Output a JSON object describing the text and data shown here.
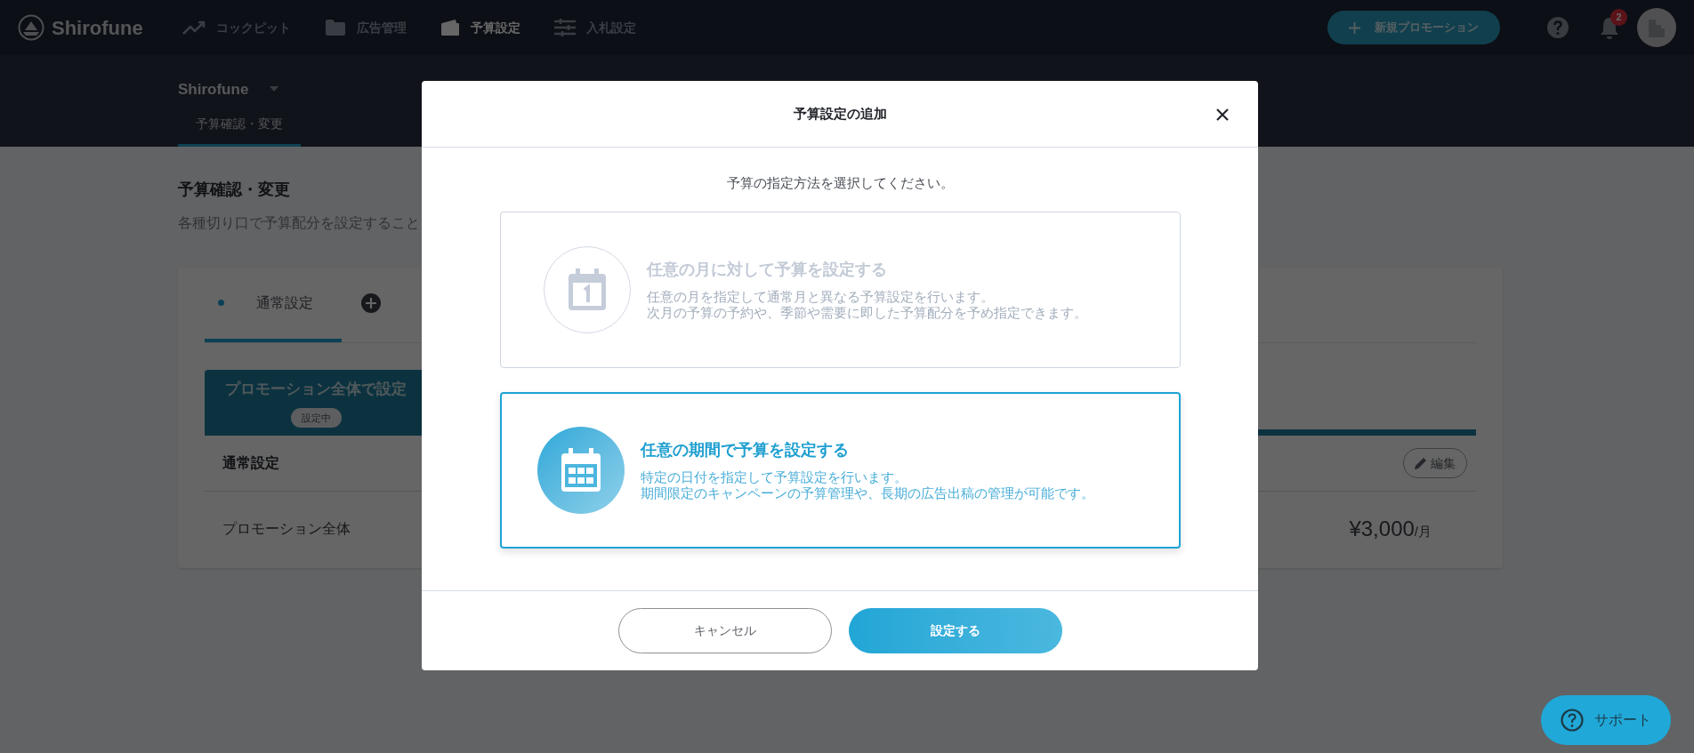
{
  "nav": {
    "logo": "Shirofune",
    "items": [
      {
        "label": "コックピット",
        "kind": "trend",
        "selected": false
      },
      {
        "label": "広告管理",
        "kind": "folder",
        "selected": false
      },
      {
        "label": "予算設定",
        "kind": "wallet",
        "selected": true
      },
      {
        "label": "入札設定",
        "kind": "sliders",
        "selected": false
      }
    ],
    "new_button": "新規プロモーション",
    "notification_count": "2"
  },
  "subheader": {
    "account": "Shirofune",
    "tabs": [
      {
        "label": "予算確認・変更",
        "selected": true
      }
    ]
  },
  "page": {
    "title": "予算確認・変更",
    "description": "各種切り口で予算配分を設定すること",
    "card": {
      "tabs": [
        {
          "label": "通常設定",
          "selected": true
        }
      ],
      "section": {
        "title": "プロモーション全体で設定",
        "badge": "設定中"
      },
      "setting_name": "通常設定",
      "edit_button": "編集",
      "rows": [
        {
          "label": "プロモーション全体",
          "amount": "¥3,000",
          "unit": "/月"
        }
      ]
    }
  },
  "modal": {
    "title": "予算設定の追加",
    "instruction": "予算の指定方法を選択してください。",
    "options": [
      {
        "kind": "month",
        "title": "任意の月に対して予算を設定する",
        "lines": [
          "任意の月を指定して通常月と異なる予算設定を行います。",
          "次月の予算の予約や、季節や需要に即した予算配分を予め指定できます。"
        ],
        "selected": false
      },
      {
        "kind": "period",
        "title": "任意の期間で予算を設定する",
        "lines": [
          "特定の日付を指定して予算設定を行います。",
          "期間限定のキャンペーンの予算管理や、長期の広告出稿の管理が可能です。"
        ],
        "selected": true
      }
    ],
    "cancel_button": "キャンセル",
    "confirm_button": "設定する"
  },
  "support_button": "サポート"
}
